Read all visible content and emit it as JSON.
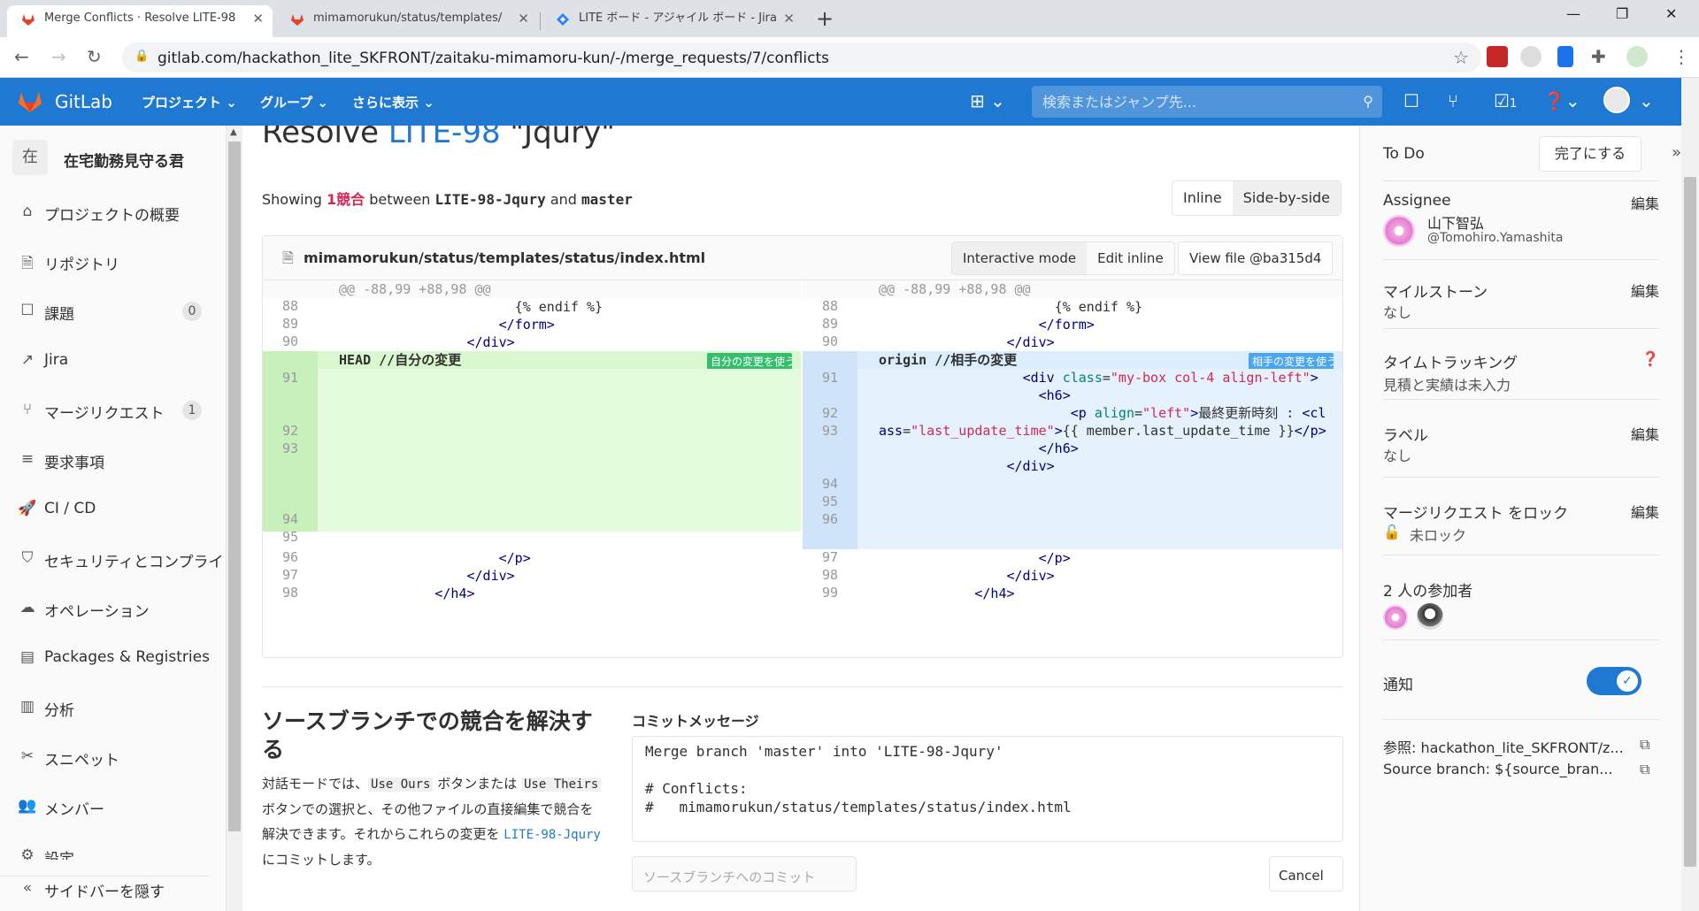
{
  "browser": {
    "tabs": [
      {
        "title": "Merge Conflicts · Resolve LITE-98",
        "active": true
      },
      {
        "title": "mimamorukun/status/templates/",
        "active": false
      },
      {
        "title": "LITE ボード - アジャイル ボード - Jira",
        "active": false
      }
    ],
    "url": "gitlab.com/hackathon_lite_SKFRONT/zaitaku-mimamoru-kun/-/merge_requests/7/conflicts"
  },
  "topnav": {
    "brand": "GitLab",
    "menus": [
      "プロジェクト",
      "グループ",
      "さらに表示"
    ],
    "search_placeholder": "検索またはジャンプ先...",
    "todo_count": "1"
  },
  "sidebar": {
    "project_initial": "在",
    "project_name": "在宅勤務見守る君",
    "items": [
      {
        "label": "プロジェクトの概要",
        "icon": "home-icon"
      },
      {
        "label": "リポジトリ",
        "icon": "document-icon"
      },
      {
        "label": "課題",
        "icon": "issues-icon",
        "badge": "0"
      },
      {
        "label": "Jira",
        "icon": "external-link-icon"
      },
      {
        "label": "マージリクエスト",
        "icon": "merge-request-icon",
        "badge": "1"
      },
      {
        "label": "要求事項",
        "icon": "requirements-icon"
      },
      {
        "label": "CI / CD",
        "icon": "rocket-icon"
      },
      {
        "label": "セキュリティとコンプライ",
        "icon": "shield-icon"
      },
      {
        "label": "オペレーション",
        "icon": "cloud-icon"
      },
      {
        "label": "Packages & Registries",
        "icon": "package-icon"
      },
      {
        "label": "分析",
        "icon": "chart-icon"
      },
      {
        "label": "スニペット",
        "icon": "scissors-icon"
      },
      {
        "label": "メンバー",
        "icon": "users-icon"
      },
      {
        "label": "設定",
        "icon": "settings-icon"
      }
    ],
    "collapse_label": "サイドバーを隠す"
  },
  "main": {
    "title_prefix": "Resolve ",
    "title_issue": "LITE-98",
    "title_suffix": " \"Jqury\"",
    "showing_prefix": "Showing ",
    "showing_count": "1",
    "showing_word": "競合",
    "showing_between": " between ",
    "source_branch": "LITE-98-Jqury",
    "showing_and": " and ",
    "target_branch": "master",
    "view_inline": "Inline",
    "view_side": "Side-by-side",
    "file": {
      "path": "mimamorukun/status/templates/status/index.html",
      "interactive_mode": "Interactive mode",
      "edit_inline": "Edit inline",
      "view_file": "View file @ba315d4",
      "hunk": "@@ -88,99 +88,98 @@",
      "ours_header": "HEAD //自分の変更",
      "ours_button": "自分の変更を使う",
      "theirs_header": "origin //相手の変更",
      "theirs_button": "相手の変更を使う"
    },
    "resolve_heading": "ソースブランチでの競合を解決する",
    "resolve_text_1": "対話モードでは、",
    "use_ours": "Use Ours",
    "resolve_text_2": " ボタンまたは ",
    "use_theirs": "Use Theirs",
    "resolve_text_3": " ボタンでの選択と、その他ファイルの直接編集で競合を解決できます。それからこれらの変更を ",
    "resolve_branch": "LITE-98-Jqury",
    "resolve_text_4": " にコミットします。",
    "commit_label": "コミットメッセージ",
    "commit_message": "Merge branch 'master' into 'LITE-98-Jqury'\n\n# Conflicts:\n#   mimamorukun/status/templates/status/index.html",
    "commit_button": "ソースブランチへのコミット",
    "cancel_button": "Cancel"
  },
  "right_sidebar": {
    "todo": "To Do",
    "mark_done": "完了にする",
    "assignee_title": "Assignee",
    "edit": "編集",
    "assignee_name": "山下智弘",
    "assignee_handle": "@Tomohiro.Yamashita",
    "milestone_title": "マイルストーン",
    "milestone_value": "なし",
    "time_title": "タイムトラッキング",
    "time_value": "見積と実績は未入力",
    "labels_title": "ラベル",
    "labels_value": "なし",
    "lock_title": "マージリクエスト をロック",
    "lock_value": "未ロック",
    "participants_title": "2 人の参加者",
    "notify_title": "通知",
    "ref": "参照: hackathon_lite_SKFRONT/z...",
    "source_branch": "Source branch: ${source_bran..."
  }
}
